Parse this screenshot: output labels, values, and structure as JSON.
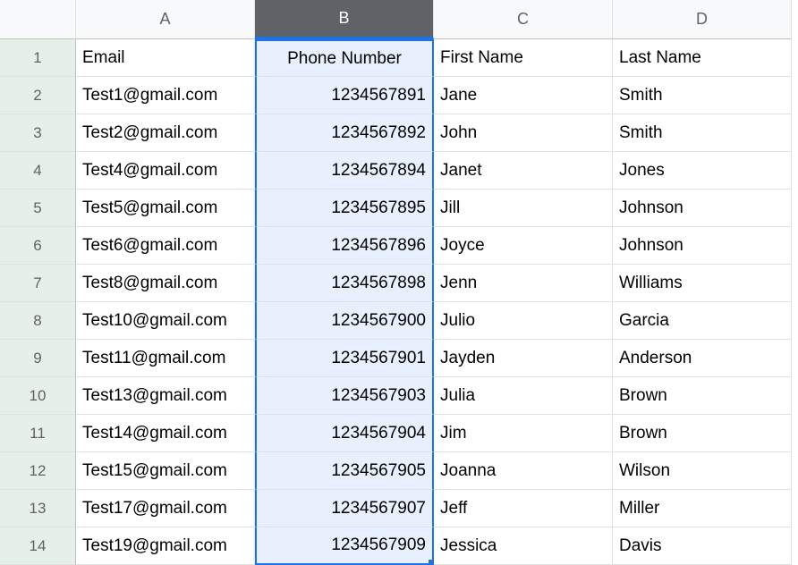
{
  "columns": [
    "A",
    "B",
    "C",
    "D"
  ],
  "selectedColumn": "B",
  "headers": {
    "A": "Email",
    "B": "Phone Number",
    "C": "First Name",
    "D": "Last Name"
  },
  "rows": [
    {
      "num": "1",
      "A": "Email",
      "B": "Phone Number",
      "C": "First Name",
      "D": "Last Name"
    },
    {
      "num": "2",
      "A": "Test1@gmail.com",
      "B": "1234567891",
      "C": "Jane",
      "D": "Smith"
    },
    {
      "num": "3",
      "A": "Test2@gmail.com",
      "B": "1234567892",
      "C": "John",
      "D": "Smith"
    },
    {
      "num": "4",
      "A": "Test4@gmail.com",
      "B": "1234567894",
      "C": "Janet",
      "D": "Jones"
    },
    {
      "num": "5",
      "A": "Test5@gmail.com",
      "B": "1234567895",
      "C": "Jill",
      "D": "Johnson"
    },
    {
      "num": "6",
      "A": "Test6@gmail.com",
      "B": "1234567896",
      "C": "Joyce",
      "D": "Johnson"
    },
    {
      "num": "7",
      "A": "Test8@gmail.com",
      "B": "1234567898",
      "C": "Jenn",
      "D": "Williams"
    },
    {
      "num": "8",
      "A": "Test10@gmail.com",
      "B": "1234567900",
      "C": "Julio",
      "D": "Garcia"
    },
    {
      "num": "9",
      "A": "Test11@gmail.com",
      "B": "1234567901",
      "C": "Jayden",
      "D": "Anderson"
    },
    {
      "num": "10",
      "A": "Test13@gmail.com",
      "B": "1234567903",
      "C": "Julia",
      "D": "Brown"
    },
    {
      "num": "11",
      "A": "Test14@gmail.com",
      "B": "1234567904",
      "C": "Jim",
      "D": "Brown"
    },
    {
      "num": "12",
      "A": "Test15@gmail.com",
      "B": "1234567905",
      "C": "Joanna",
      "D": "Wilson"
    },
    {
      "num": "13",
      "A": "Test17@gmail.com",
      "B": "1234567907",
      "C": "Jeff",
      "D": "Miller"
    },
    {
      "num": "14",
      "A": "Test19@gmail.com",
      "B": "1234567909",
      "C": "Jessica",
      "D": "Davis"
    }
  ]
}
